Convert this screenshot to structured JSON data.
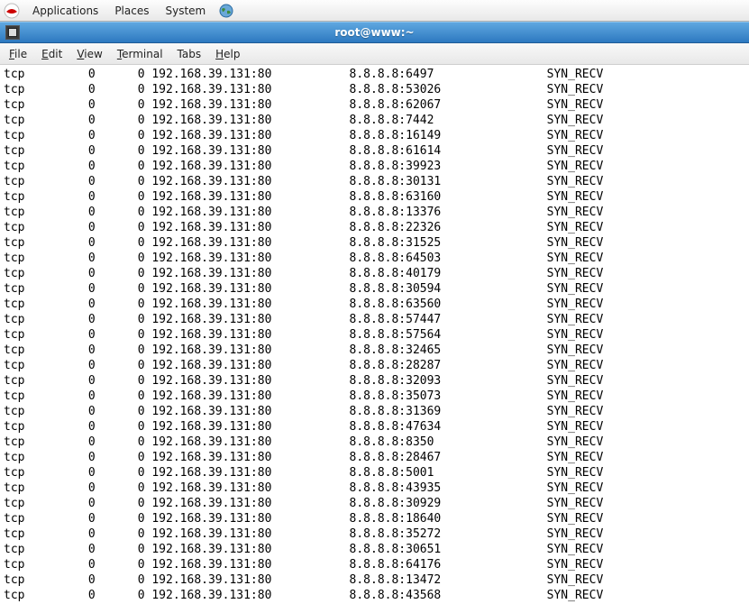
{
  "panel": {
    "app_menu": "Applications",
    "places": "Places",
    "system": "System"
  },
  "window": {
    "title": "root@www:~"
  },
  "menubar": {
    "file": {
      "label": "File",
      "mn": "F",
      "rest": "ile"
    },
    "edit": {
      "label": "Edit",
      "mn": "E",
      "rest": "dit"
    },
    "view": {
      "label": "View",
      "mn": "V",
      "rest": "iew"
    },
    "term": {
      "label": "Terminal",
      "mn": "T",
      "rest": "erminal"
    },
    "tabs": {
      "label": "Tabs",
      "mn": "",
      "rest": "Tabs"
    },
    "help": {
      "label": "Help",
      "mn": "H",
      "rest": "elp"
    }
  },
  "connections": [
    {
      "proto": "tcp",
      "recvq": "0",
      "sendq": "0",
      "local": "192.168.39.131:80",
      "foreign": "8.8.8.8:6497",
      "state": "SYN_RECV"
    },
    {
      "proto": "tcp",
      "recvq": "0",
      "sendq": "0",
      "local": "192.168.39.131:80",
      "foreign": "8.8.8.8:53026",
      "state": "SYN_RECV"
    },
    {
      "proto": "tcp",
      "recvq": "0",
      "sendq": "0",
      "local": "192.168.39.131:80",
      "foreign": "8.8.8.8:62067",
      "state": "SYN_RECV"
    },
    {
      "proto": "tcp",
      "recvq": "0",
      "sendq": "0",
      "local": "192.168.39.131:80",
      "foreign": "8.8.8.8:7442",
      "state": "SYN_RECV"
    },
    {
      "proto": "tcp",
      "recvq": "0",
      "sendq": "0",
      "local": "192.168.39.131:80",
      "foreign": "8.8.8.8:16149",
      "state": "SYN_RECV"
    },
    {
      "proto": "tcp",
      "recvq": "0",
      "sendq": "0",
      "local": "192.168.39.131:80",
      "foreign": "8.8.8.8:61614",
      "state": "SYN_RECV"
    },
    {
      "proto": "tcp",
      "recvq": "0",
      "sendq": "0",
      "local": "192.168.39.131:80",
      "foreign": "8.8.8.8:39923",
      "state": "SYN_RECV"
    },
    {
      "proto": "tcp",
      "recvq": "0",
      "sendq": "0",
      "local": "192.168.39.131:80",
      "foreign": "8.8.8.8:30131",
      "state": "SYN_RECV"
    },
    {
      "proto": "tcp",
      "recvq": "0",
      "sendq": "0",
      "local": "192.168.39.131:80",
      "foreign": "8.8.8.8:63160",
      "state": "SYN_RECV"
    },
    {
      "proto": "tcp",
      "recvq": "0",
      "sendq": "0",
      "local": "192.168.39.131:80",
      "foreign": "8.8.8.8:13376",
      "state": "SYN_RECV"
    },
    {
      "proto": "tcp",
      "recvq": "0",
      "sendq": "0",
      "local": "192.168.39.131:80",
      "foreign": "8.8.8.8:22326",
      "state": "SYN_RECV"
    },
    {
      "proto": "tcp",
      "recvq": "0",
      "sendq": "0",
      "local": "192.168.39.131:80",
      "foreign": "8.8.8.8:31525",
      "state": "SYN_RECV"
    },
    {
      "proto": "tcp",
      "recvq": "0",
      "sendq": "0",
      "local": "192.168.39.131:80",
      "foreign": "8.8.8.8:64503",
      "state": "SYN_RECV"
    },
    {
      "proto": "tcp",
      "recvq": "0",
      "sendq": "0",
      "local": "192.168.39.131:80",
      "foreign": "8.8.8.8:40179",
      "state": "SYN_RECV"
    },
    {
      "proto": "tcp",
      "recvq": "0",
      "sendq": "0",
      "local": "192.168.39.131:80",
      "foreign": "8.8.8.8:30594",
      "state": "SYN_RECV"
    },
    {
      "proto": "tcp",
      "recvq": "0",
      "sendq": "0",
      "local": "192.168.39.131:80",
      "foreign": "8.8.8.8:63560",
      "state": "SYN_RECV"
    },
    {
      "proto": "tcp",
      "recvq": "0",
      "sendq": "0",
      "local": "192.168.39.131:80",
      "foreign": "8.8.8.8:57447",
      "state": "SYN_RECV"
    },
    {
      "proto": "tcp",
      "recvq": "0",
      "sendq": "0",
      "local": "192.168.39.131:80",
      "foreign": "8.8.8.8:57564",
      "state": "SYN_RECV"
    },
    {
      "proto": "tcp",
      "recvq": "0",
      "sendq": "0",
      "local": "192.168.39.131:80",
      "foreign": "8.8.8.8:32465",
      "state": "SYN_RECV"
    },
    {
      "proto": "tcp",
      "recvq": "0",
      "sendq": "0",
      "local": "192.168.39.131:80",
      "foreign": "8.8.8.8:28287",
      "state": "SYN_RECV"
    },
    {
      "proto": "tcp",
      "recvq": "0",
      "sendq": "0",
      "local": "192.168.39.131:80",
      "foreign": "8.8.8.8:32093",
      "state": "SYN_RECV"
    },
    {
      "proto": "tcp",
      "recvq": "0",
      "sendq": "0",
      "local": "192.168.39.131:80",
      "foreign": "8.8.8.8:35073",
      "state": "SYN_RECV"
    },
    {
      "proto": "tcp",
      "recvq": "0",
      "sendq": "0",
      "local": "192.168.39.131:80",
      "foreign": "8.8.8.8:31369",
      "state": "SYN_RECV"
    },
    {
      "proto": "tcp",
      "recvq": "0",
      "sendq": "0",
      "local": "192.168.39.131:80",
      "foreign": "8.8.8.8:47634",
      "state": "SYN_RECV"
    },
    {
      "proto": "tcp",
      "recvq": "0",
      "sendq": "0",
      "local": "192.168.39.131:80",
      "foreign": "8.8.8.8:8350",
      "state": "SYN_RECV"
    },
    {
      "proto": "tcp",
      "recvq": "0",
      "sendq": "0",
      "local": "192.168.39.131:80",
      "foreign": "8.8.8.8:28467",
      "state": "SYN_RECV"
    },
    {
      "proto": "tcp",
      "recvq": "0",
      "sendq": "0",
      "local": "192.168.39.131:80",
      "foreign": "8.8.8.8:5001",
      "state": "SYN_RECV"
    },
    {
      "proto": "tcp",
      "recvq": "0",
      "sendq": "0",
      "local": "192.168.39.131:80",
      "foreign": "8.8.8.8:43935",
      "state": "SYN_RECV"
    },
    {
      "proto": "tcp",
      "recvq": "0",
      "sendq": "0",
      "local": "192.168.39.131:80",
      "foreign": "8.8.8.8:30929",
      "state": "SYN_RECV"
    },
    {
      "proto": "tcp",
      "recvq": "0",
      "sendq": "0",
      "local": "192.168.39.131:80",
      "foreign": "8.8.8.8:18640",
      "state": "SYN_RECV"
    },
    {
      "proto": "tcp",
      "recvq": "0",
      "sendq": "0",
      "local": "192.168.39.131:80",
      "foreign": "8.8.8.8:35272",
      "state": "SYN_RECV"
    },
    {
      "proto": "tcp",
      "recvq": "0",
      "sendq": "0",
      "local": "192.168.39.131:80",
      "foreign": "8.8.8.8:30651",
      "state": "SYN_RECV"
    },
    {
      "proto": "tcp",
      "recvq": "0",
      "sendq": "0",
      "local": "192.168.39.131:80",
      "foreign": "8.8.8.8:64176",
      "state": "SYN_RECV"
    },
    {
      "proto": "tcp",
      "recvq": "0",
      "sendq": "0",
      "local": "192.168.39.131:80",
      "foreign": "8.8.8.8:13472",
      "state": "SYN_RECV"
    },
    {
      "proto": "tcp",
      "recvq": "0",
      "sendq": "0",
      "local": "192.168.39.131:80",
      "foreign": "8.8.8.8:43568",
      "state": "SYN_RECV"
    }
  ],
  "columns": {
    "proto": 6,
    "recvq": 7,
    "sendq": 7,
    "local": 28,
    "foreign": 28,
    "state": 12
  }
}
